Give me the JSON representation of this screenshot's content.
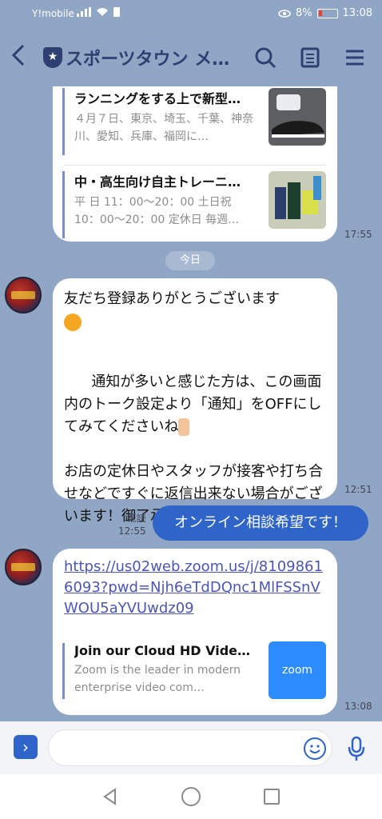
{
  "status": {
    "carrier": "Y!mobile",
    "battery": "8%",
    "time": "13:08"
  },
  "header": {
    "title": "スポーツタウン メ…"
  },
  "top_card": {
    "items": [
      {
        "title": "ランニングをする上で新型…",
        "desc": "４月７日、東京、埼玉、千葉、神奈川、愛知、兵庫、福岡に…"
      },
      {
        "title": "中・高生向け自主トレーニ…",
        "desc": "平 日 11：00〜20：00 土日祝 10：00〜20：00 定休日 毎週…"
      }
    ],
    "time": "17:55"
  },
  "date_label": "今日",
  "welcome": {
    "line1": "友だち登録ありがとうございます",
    "body1": "通知が多いと感じた方は、この画面内のトーク設定より「通知」をOFFにしてみてくださいね",
    "body2": "お店の定休日やスタッフが接客や打ち合せなどですぐに返信出来ない場合がございます！御了承ください。",
    "time": "12:51"
  },
  "sent": {
    "text": "オンライン相談希望です！",
    "read_label": "既読",
    "time": "12:55"
  },
  "zoom_msg": {
    "link": "https://us02web.zoom.us/j/81098616093?pwd=Njh6eTdDQnc1MlFSSnVWOU5aYVUwdz09",
    "card_title": "Join our Cloud HD Video M…",
    "card_desc": "Zoom is the leader in modern enterprise video com…",
    "logo_text": "zoom",
    "time": "13:08"
  },
  "colors": {
    "chat_bg": "#8fa6c4",
    "sent_bubble": "#2f64c8",
    "accent": "#2e3f72"
  }
}
